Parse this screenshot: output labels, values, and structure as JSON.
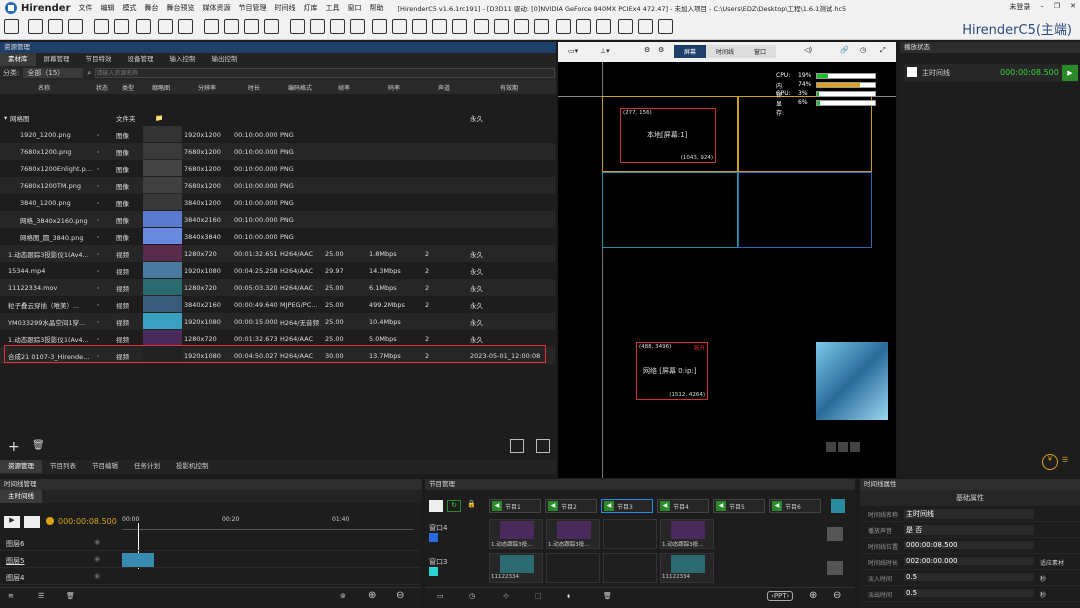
{
  "app": {
    "name": "Hirender",
    "menu": [
      "文件",
      "编辑",
      "模式",
      "舞台",
      "舞台预览",
      "媒体资源",
      "节目管理",
      "时间线",
      "灯库",
      "工具",
      "窗口",
      "帮助"
    ],
    "window_title": "[HirenderC5 v1.6.1rc191] - [D3D11 驱动: [0]NVIDIA GeForce 940MX PCIEx4 472.47] - 未加入项目 - C:\\Users\\EDZ\\Desktop\\工程\\1.6.1测试.hc5",
    "login": "未登录",
    "brand": "HirenderC5(主端)"
  },
  "resource": {
    "title": "资源管理",
    "tabs": [
      "素材库",
      "屏幕管理",
      "节目特效",
      "设备管理",
      "输入控制",
      "输出控制"
    ],
    "filter_label": "分类:",
    "filter_value": "全部（15）",
    "search_placeholder": "请输入资源名称",
    "columns": [
      "名称",
      "状态",
      "类型",
      "缩略图",
      "分辨率",
      "时长",
      "编码格式",
      "帧率",
      "码率",
      "声道",
      "有效期"
    ],
    "folder": {
      "name": "网格图",
      "type": "文件夹",
      "expiry": "永久"
    },
    "rows": [
      {
        "name": "1920_1200.png",
        "type": "图像",
        "res": "1920x1200",
        "dur": "00:10:00.000",
        "codec": "PNG",
        "fps": "",
        "rate": "",
        "ch": "",
        "exp": "",
        "thumb": "#333"
      },
      {
        "name": "7680x1200.png",
        "type": "图像",
        "res": "7680x1200",
        "dur": "00:10:00.000",
        "codec": "PNG",
        "fps": "",
        "rate": "",
        "ch": "",
        "exp": "",
        "thumb": "#3a3a3a"
      },
      {
        "name": "7680x1200Enlight.p...",
        "type": "图像",
        "res": "7680x1200",
        "dur": "00:10:00.000",
        "codec": "PNG",
        "fps": "",
        "rate": "",
        "ch": "",
        "exp": "",
        "thumb": "#444"
      },
      {
        "name": "7680x1200TM.png",
        "type": "图像",
        "res": "7680x1200",
        "dur": "00:10:00.000",
        "codec": "PNG",
        "fps": "",
        "rate": "",
        "ch": "",
        "exp": "",
        "thumb": "#404040"
      },
      {
        "name": "3840_1200.png",
        "type": "图像",
        "res": "3840x1200",
        "dur": "00:10:00.000",
        "codec": "PNG",
        "fps": "",
        "rate": "",
        "ch": "",
        "exp": "",
        "thumb": "#383838"
      },
      {
        "name": "网格_3840x2160.png",
        "type": "图像",
        "res": "3840x2160",
        "dur": "00:10:00.000",
        "codec": "PNG",
        "fps": "",
        "rate": "",
        "ch": "",
        "exp": "",
        "thumb": "#5a7ad0"
      },
      {
        "name": "网格图_圆_3840.png",
        "type": "图像",
        "res": "3840x3840",
        "dur": "00:10:00.000",
        "codec": "PNG",
        "fps": "",
        "rate": "",
        "ch": "",
        "exp": "",
        "thumb": "#6a8ae0"
      },
      {
        "name": "1.动态跟踪3投影仪1(Av4...",
        "type": "视频",
        "res": "1280x720",
        "dur": "00:01:32.651",
        "codec": "H264/AAC",
        "fps": "25.00",
        "rate": "1.8Mbps",
        "ch": "2",
        "exp": "永久",
        "thumb": "#5a2a4a"
      },
      {
        "name": "15344.mp4",
        "type": "视频",
        "res": "1920x1080",
        "dur": "00:04:25.258",
        "codec": "H264/AAC",
        "fps": "29.97",
        "rate": "14.3Mbps",
        "ch": "2",
        "exp": "永久",
        "thumb": "#4a7aa0"
      },
      {
        "name": "11122334.mov",
        "type": "视频",
        "res": "1280x720",
        "dur": "00:05:03.320",
        "codec": "H264/AAC",
        "fps": "25.00",
        "rate": "6.1Mbps",
        "ch": "2",
        "exp": "永久",
        "thumb": "#2a6a70"
      },
      {
        "name": "粒子叠云穿插（唯美）...",
        "type": "视频",
        "res": "3840x2160",
        "dur": "00:00:49.640",
        "codec": "MJPEG/PC...",
        "fps": "25.00",
        "rate": "499.2Mbps",
        "ch": "2",
        "exp": "永久",
        "thumb": "#3a5a7a"
      },
      {
        "name": "YM033299水晶空间1穿...",
        "type": "视频",
        "res": "1920x1080",
        "dur": "00:00:15.000",
        "codec": "H264/无音频",
        "fps": "25.00",
        "rate": "10.4Mbps",
        "ch": "",
        "exp": "永久",
        "thumb": "#3aa0c0"
      },
      {
        "name": "1.动态跟踪3投影仪1(Av4...",
        "type": "视频",
        "res": "1280x720",
        "dur": "00:01:32.673",
        "codec": "H264/AAC",
        "fps": "25.00",
        "rate": "5.0Mbps",
        "ch": "2",
        "exp": "永久",
        "thumb": "#4a2a5a"
      },
      {
        "name": "合成21 0107-3_Hirende...",
        "type": "视频",
        "res": "1920x1080",
        "dur": "00:04:50.027",
        "codec": "H264/AAC",
        "fps": "30.00",
        "rate": "13.7Mbps",
        "ch": "2",
        "exp": "2023-05-01_12:00:08",
        "thumb": "#222"
      }
    ],
    "bottom_tabs": [
      "资源管理",
      "节目列表",
      "节目编辑",
      "任务计划",
      "投影机控制"
    ]
  },
  "stage": {
    "tabs": [
      "屏幕",
      "时间线",
      "窗口"
    ],
    "stats": [
      {
        "label": "CPU:",
        "value": "19%",
        "pct": 0.19,
        "color": "#1bbf2a"
      },
      {
        "label": "内存:",
        "value": "74%",
        "pct": 0.74,
        "color": "#d9a21a"
      },
      {
        "label": "GPU:",
        "value": "3%",
        "pct": 0.03,
        "color": "#1bbf2a"
      },
      {
        "label": "显存:",
        "value": "6%",
        "pct": 0.06,
        "color": "#1bbf2a"
      }
    ],
    "screen1": {
      "label": "本地[屏幕:1]",
      "tl": "(277, 156)",
      "br": "(1043, 924)"
    },
    "screen2": {
      "label": "网络 [屏幕 0:ip:]",
      "tl": "(488, 3496)",
      "br": "(1512, 4264)",
      "status": "断开"
    }
  },
  "playback": {
    "title": "播放状态",
    "item": "主时间线",
    "time": "000:00:08.500"
  },
  "timeline": {
    "title": "时间线管理",
    "tab": "主时间线",
    "time": "000:00:08.500",
    "ticks": [
      "00:00",
      "00:20",
      "01:40"
    ],
    "layers": [
      "图层6",
      "图层5",
      "图层4"
    ]
  },
  "program": {
    "title": "节目管理",
    "slots": [
      "节目1",
      "节目2",
      "节目3",
      "节目4",
      "节目5",
      "节目6"
    ],
    "windows": [
      {
        "name": "窗口4",
        "clips": [
          "1.动态跟踪3投...",
          "1.动态跟踪3投...",
          "",
          "1.动态跟踪3投..."
        ]
      },
      {
        "name": "窗口3",
        "clips": [
          "11122334",
          "",
          "",
          "11122334"
        ]
      }
    ],
    "ppt": "PPT"
  },
  "props": {
    "title": "时间线属性",
    "section": "基础属性",
    "fields": [
      {
        "k": "时间线名称",
        "v": "主时间线"
      },
      {
        "k": "播放声音",
        "v": "是  否"
      },
      {
        "k": "时间线位置",
        "v": "000:00:08.500"
      },
      {
        "k": "时间线时长",
        "v": "002:00:00.000",
        "extra": "适应素材"
      },
      {
        "k": "淡入时间",
        "v": "0.5",
        "extra": "秒"
      },
      {
        "k": "淡出时间",
        "v": "0.5",
        "extra": "秒"
      }
    ]
  }
}
